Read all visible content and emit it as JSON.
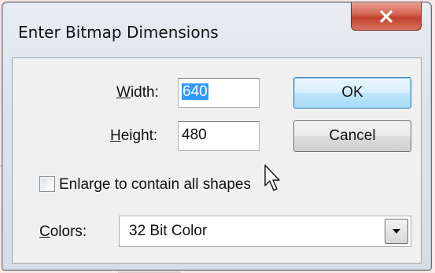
{
  "window": {
    "title": "Enter Bitmap Dimensions",
    "close_icon": "close-x-icon"
  },
  "fields": {
    "width_label_accel": "W",
    "width_label_rest": "idth:",
    "width_value": "640",
    "height_label_accel": "H",
    "height_label_rest": "eight:",
    "height_value": "480"
  },
  "buttons": {
    "ok_label": "OK",
    "cancel_label": "Cancel"
  },
  "enlarge": {
    "label": "Enlarge to contain all shapes",
    "checked": false
  },
  "colors": {
    "label_accel": "C",
    "label_rest": "olors:",
    "selected": "32 Bit Color",
    "dropdown_icon": "chevron-down-icon"
  },
  "cursor_icon": "mouse-pointer-icon",
  "theme": {
    "selection": "#3399ff",
    "close_button": "#c0402c",
    "default_button": "#bee6fd"
  }
}
